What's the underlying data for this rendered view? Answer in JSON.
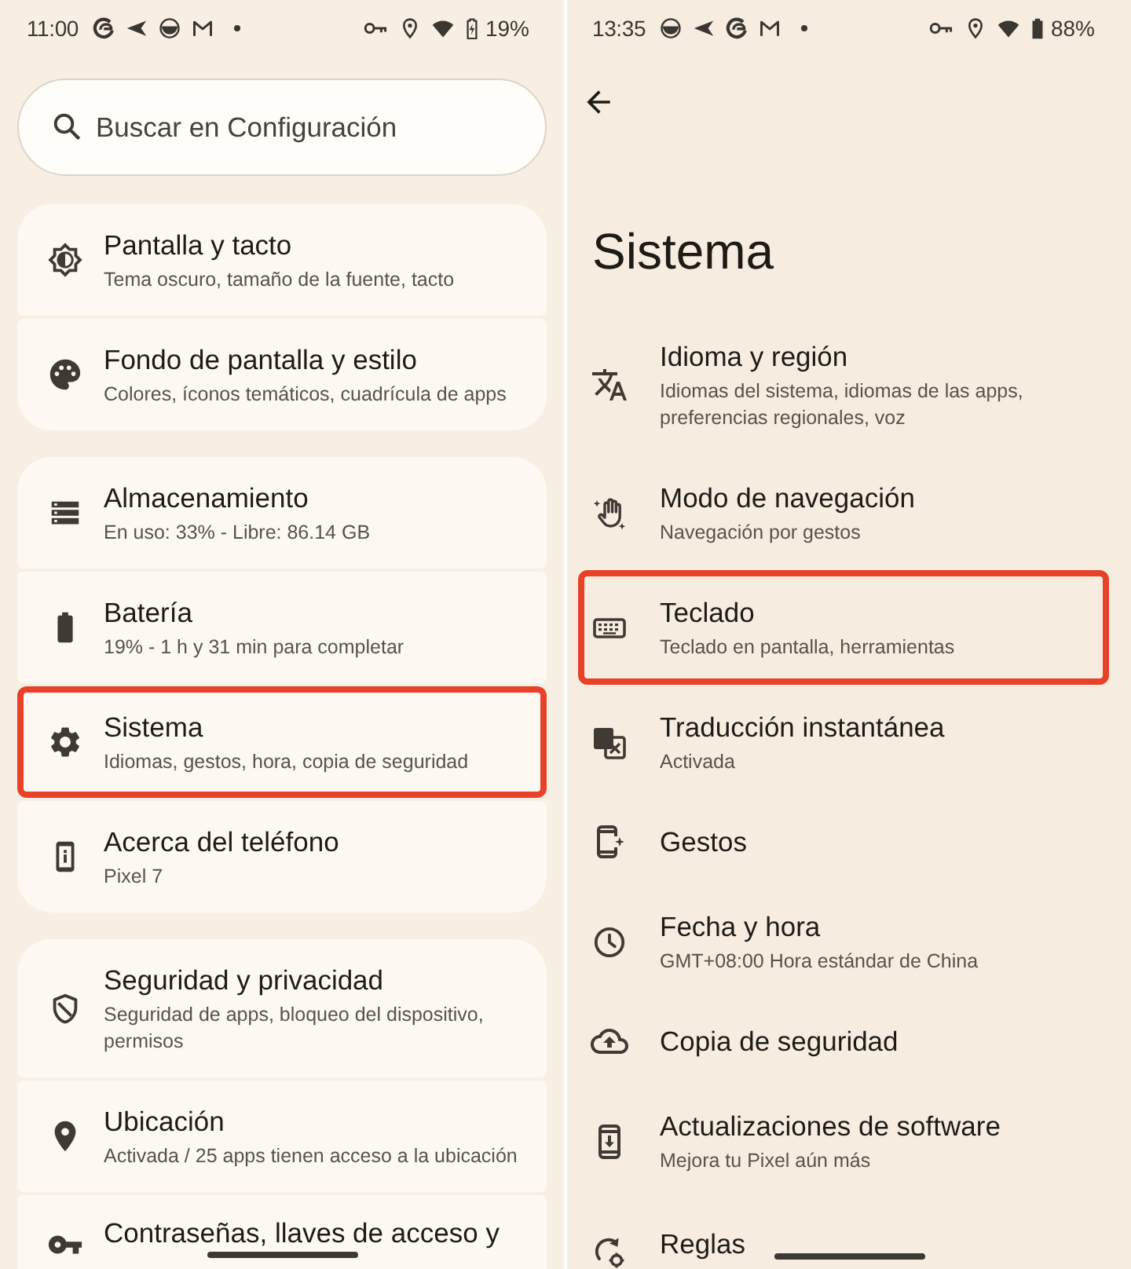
{
  "left_screen": {
    "status_bar": {
      "time": "11:00",
      "battery_charging": true,
      "battery_percent": "19%"
    },
    "search": {
      "placeholder": "Buscar en Configuración"
    },
    "groups": [
      {
        "items": [
          {
            "title": "Pantalla y tacto",
            "summary": "Tema oscuro, tamaño de la fuente, tacto",
            "highlighted": false
          },
          {
            "title": "Fondo de pantalla y estilo",
            "summary": "Colores, íconos temáticos, cuadrícula de apps",
            "highlighted": false
          }
        ]
      },
      {
        "items": [
          {
            "title": "Almacenamiento",
            "summary": "En uso: 33% - Libre: 86.14 GB",
            "highlighted": false
          },
          {
            "title": "Batería",
            "summary": "19% - 1 h y 31 min para completar",
            "highlighted": false
          },
          {
            "title": "Sistema",
            "summary": "Idiomas, gestos, hora, copia de seguridad",
            "highlighted": true
          },
          {
            "title": "Acerca del teléfono",
            "summary": "Pixel 7",
            "highlighted": false
          }
        ]
      },
      {
        "items": [
          {
            "title": "Seguridad y privacidad",
            "summary": "Seguridad de apps, bloqueo del dispositivo, permisos",
            "highlighted": false
          },
          {
            "title": "Ubicación",
            "summary": "Activada / 25 apps tienen acceso a la ubicación",
            "highlighted": false
          },
          {
            "title": "Contraseñas, llaves de acceso y",
            "highlighted": false
          }
        ]
      }
    ]
  },
  "right_screen": {
    "status_bar": {
      "time": "13:35",
      "battery_charging": false,
      "battery_percent": "88%"
    },
    "title": "Sistema",
    "items": [
      {
        "title": "Idioma y región",
        "summary": "Idiomas del sistema, idiomas de las apps, preferencias regionales, voz",
        "highlighted": false
      },
      {
        "title": "Modo de navegación",
        "summary": "Navegación por gestos",
        "highlighted": false
      },
      {
        "title": "Teclado",
        "summary": "Teclado en pantalla, herramientas",
        "highlighted": true
      },
      {
        "title": "Traducción instantánea",
        "summary": "Activada",
        "highlighted": false
      },
      {
        "title": "Gestos",
        "highlighted": false
      },
      {
        "title": "Fecha y hora",
        "summary": "GMT+08:00 Hora estándar de China",
        "highlighted": false
      },
      {
        "title": "Copia de seguridad",
        "highlighted": false
      },
      {
        "title": "Actualizaciones de software",
        "summary": "Mejora tu Pixel aún más",
        "highlighted": false
      },
      {
        "title": "Reglas",
        "highlighted": false
      }
    ]
  }
}
